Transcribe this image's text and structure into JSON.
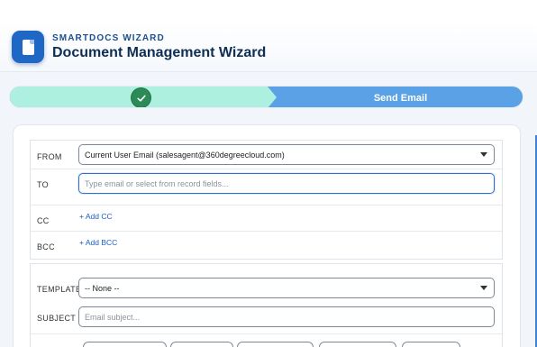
{
  "header": {
    "brand": "SMARTDOCS WIZARD",
    "title": "Document Management Wizard"
  },
  "progress": {
    "completed_step_icon": "check-icon",
    "current_step_label": "Send Email"
  },
  "email": {
    "from_label": "FROM",
    "from_value": "Current User Email (salesagent@360degreecloud.com)",
    "to_label": "TO",
    "to_placeholder": "Type email or select from record fields...",
    "cc_label": "CC",
    "add_cc": "+ Add CC",
    "bcc_label": "BCC",
    "add_bcc": "+ Add BCC",
    "template_label": "TEMPLATE",
    "template_value": "-- None --",
    "subject_label": "SUBJECT",
    "subject_placeholder": "Email subject..."
  },
  "colors": {
    "accent": "#1f67c4",
    "done_step": "#aef0e0",
    "current_step": "#5aa1e6",
    "check": "#2b8a56"
  }
}
